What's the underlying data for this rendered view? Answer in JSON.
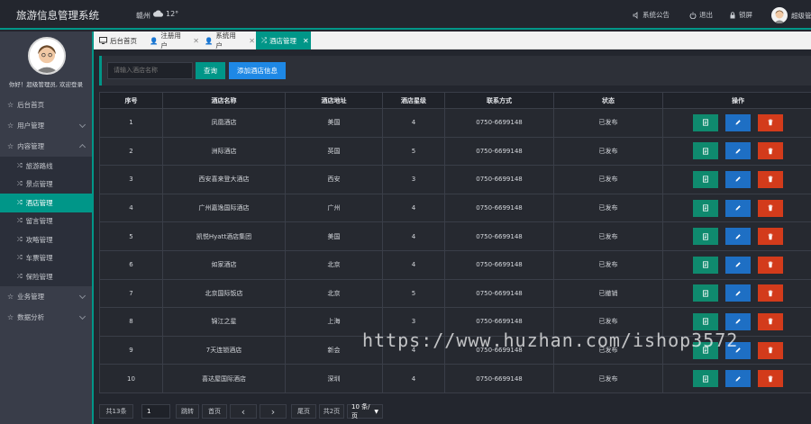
{
  "header": {
    "title": "旅游信息管理系统",
    "city": "赣州",
    "temp": "12°",
    "notice": "系统公告",
    "logout": "退出",
    "lock": "锁屏",
    "user": "超级管"
  },
  "sidebar": {
    "welcome": "你好！超级管理员, 欢迎登录",
    "items": [
      {
        "label": "后台首页"
      },
      {
        "label": "用户管理"
      },
      {
        "label": "内容管理"
      }
    ],
    "sub": [
      {
        "label": "旅游路线"
      },
      {
        "label": "景点管理"
      },
      {
        "label": "酒店管理"
      },
      {
        "label": "留言管理"
      },
      {
        "label": "攻略管理"
      },
      {
        "label": "车票管理"
      },
      {
        "label": "保险管理"
      }
    ],
    "items2": [
      {
        "label": "业务管理"
      },
      {
        "label": "数据分析"
      }
    ]
  },
  "tabs": [
    {
      "label": "后台首页"
    },
    {
      "label": "注册用户"
    },
    {
      "label": "系统用户"
    },
    {
      "label": "酒店管理"
    }
  ],
  "toolbar": {
    "search_placeholder": "请输入酒店名称",
    "query": "查询",
    "add": "添加酒店信息"
  },
  "table": {
    "columns": [
      "序号",
      "酒店名称",
      "酒店地址",
      "酒店星级",
      "联系方式",
      "状态",
      "操作"
    ],
    "rows": [
      [
        "1",
        "凤凰酒店",
        "美国",
        "4",
        "0750-6699148",
        "已发布"
      ],
      [
        "2",
        "洲际酒店",
        "英国",
        "5",
        "0750-6699148",
        "已发布"
      ],
      [
        "3",
        "西安喜来登大酒店",
        "西安",
        "3",
        "0750-6699148",
        "已发布"
      ],
      [
        "4",
        "广州嘉逸国际酒店",
        "广州",
        "4",
        "0750-6699148",
        "已发布"
      ],
      [
        "5",
        "凯悦Hyatt酒店集团",
        "美国",
        "4",
        "0750-6699148",
        "已发布"
      ],
      [
        "6",
        "如家酒店",
        "北京",
        "4",
        "0750-6699148",
        "已发布"
      ],
      [
        "7",
        "北京国际饭店",
        "北京",
        "5",
        "0750-6699148",
        "已撤销"
      ],
      [
        "8",
        "锦江之星",
        "上海",
        "3",
        "0750-6699148",
        "已发布"
      ],
      [
        "9",
        "7天连锁酒店",
        "新会",
        "4",
        "0750-6699148",
        "已发布"
      ],
      [
        "10",
        "喜达屋国际酒店",
        "深圳",
        "4",
        "0750-6699148",
        "已发布"
      ]
    ]
  },
  "pager": {
    "total": "共13条",
    "page_input": "1",
    "jump": "跳转",
    "first": "首页",
    "last": "尾页",
    "pages": "共2页",
    "per_page": "10 条/页"
  },
  "watermark": "https://www.huzhan.com/ishop3572",
  "colors": {
    "accent": "#009688",
    "blue": "#1e6fc4",
    "red": "#d33b1b"
  }
}
